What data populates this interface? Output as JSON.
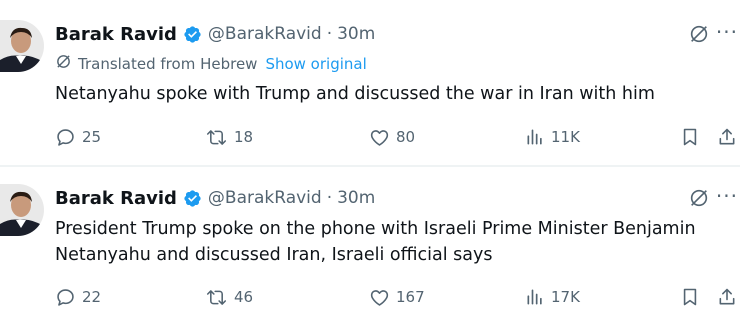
{
  "tweets": [
    {
      "author": {
        "name": "Barak Ravid",
        "handle": "@BarakRavid",
        "dot": "·",
        "time": "30m"
      },
      "translation": {
        "label": "Translated from Hebrew",
        "link": "Show original"
      },
      "text_lines": [
        "Netanyahu spoke with Trump and discussed the war in Iran with him"
      ],
      "actions": {
        "replies": "25",
        "reposts": "18",
        "likes": "80",
        "views": "11K"
      }
    },
    {
      "author": {
        "name": "Barak Ravid",
        "handle": "@BarakRavid",
        "dot": "·",
        "time": "30m"
      },
      "text_lines": [
        "President Trump spoke on the phone with Israeli Prime Minister Benjamin",
        "Netanyahu and discussed Iran, Israeli official says"
      ],
      "actions": {
        "replies": "22",
        "reposts": "46",
        "likes": "167",
        "views": "17K"
      }
    }
  ],
  "more_label": "···",
  "colors": {
    "verified": "#1d9bf0",
    "link": "#1d9bf0",
    "muted": "#536471",
    "text": "#0f1419"
  },
  "icons": [
    "verified-badge-icon",
    "grok-translate-icon",
    "more-icon",
    "reply-icon",
    "repost-icon",
    "like-icon",
    "views-icon",
    "bookmark-icon",
    "share-icon"
  ]
}
